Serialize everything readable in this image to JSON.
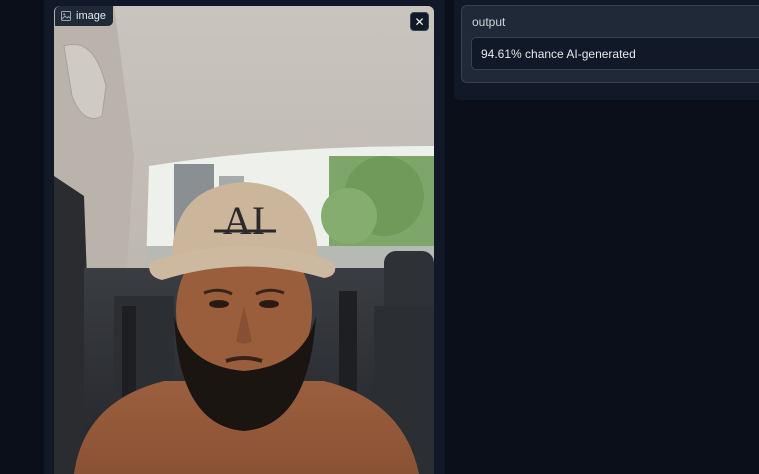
{
  "input": {
    "label": "image",
    "label_icon": "image-icon",
    "clear_icon": "close-icon",
    "cap_text": "AI"
  },
  "output": {
    "label": "output",
    "value": "94.61% chance AI-generated"
  },
  "colors": {
    "background": "#0b0f19",
    "panel": "#111827",
    "block": "#1f2937",
    "border": "#374151"
  }
}
